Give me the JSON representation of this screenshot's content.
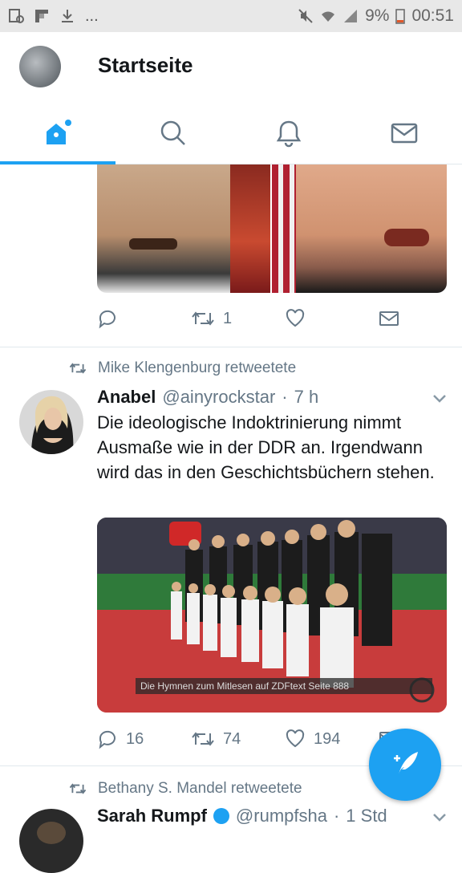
{
  "status_bar": {
    "battery": "9%",
    "time": "00:51",
    "more": "..."
  },
  "header": {
    "title": "Startseite"
  },
  "tabs": [
    {
      "name": "home",
      "icon": "home-icon",
      "active": true
    },
    {
      "name": "search",
      "icon": "search-icon",
      "active": false
    },
    {
      "name": "notifications",
      "icon": "bell-icon",
      "active": false
    },
    {
      "name": "messages",
      "icon": "mail-icon",
      "active": false
    }
  ],
  "tweet1": {
    "retweets": "1"
  },
  "tweet2": {
    "retweet_by": "Mike Klengenburg retweetete",
    "name": "Anabel",
    "handle": "@ainyrockstar",
    "separator": "·",
    "time": "7 h",
    "text": "Die ideologische Indoktrinierung nimmt Ausmaße wie in der DDR an. Irgendwann wird das in den Geschichtsbüchern stehen.",
    "media_caption": "Die Hymnen zum Mitlesen auf ZDFtext Seite 888",
    "replies": "16",
    "retweets": "74",
    "likes": "194"
  },
  "tweet3": {
    "retweet_by": "Bethany S. Mandel retweetete",
    "name": "Sarah Rumpf",
    "handle": "@rumpfsha",
    "separator": "·",
    "time": "1 Std"
  },
  "colors": {
    "accent": "#1da1f2",
    "muted": "#657786",
    "text": "#14171a"
  }
}
